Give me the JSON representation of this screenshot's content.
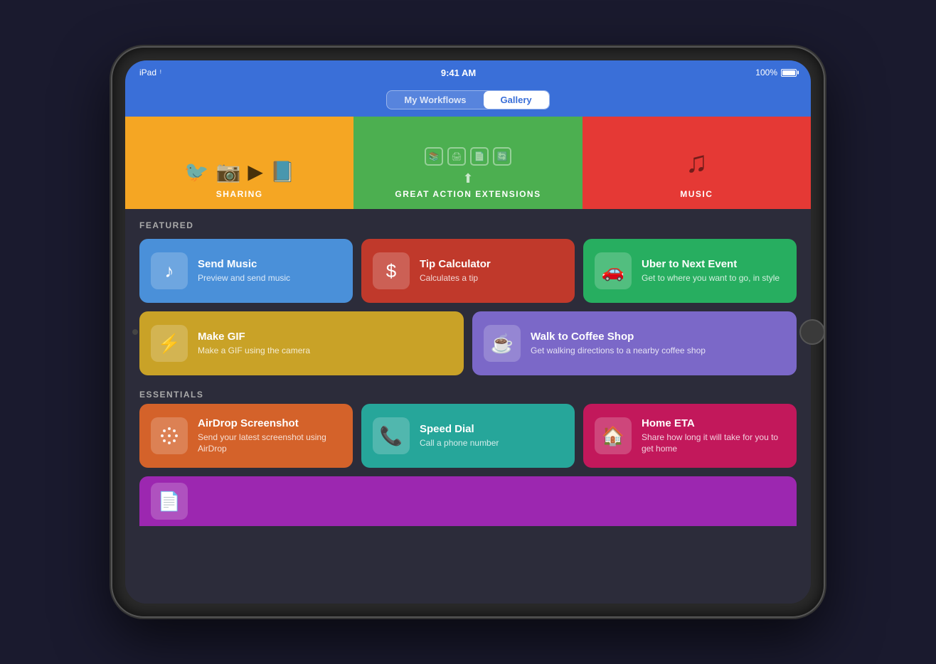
{
  "status_bar": {
    "device": "iPad",
    "wifi": "wifi",
    "time": "9:41 AM",
    "battery": "100%"
  },
  "nav": {
    "tab_my_workflows": "My Workflows",
    "tab_gallery": "Gallery",
    "active_tab": "gallery"
  },
  "banners": [
    {
      "id": "sharing",
      "label": "SHARING",
      "color": "#f5a623",
      "icons": [
        "🐦",
        "📷",
        "▶",
        "📘"
      ]
    },
    {
      "id": "extensions",
      "label": "GREAT ACTION EXTENSIONS",
      "color": "#4caf50"
    },
    {
      "id": "music",
      "label": "MUSIC",
      "color": "#e53935"
    }
  ],
  "sections": {
    "featured": {
      "title": "FEATURED",
      "cards": [
        {
          "id": "send-music",
          "title": "Send Music",
          "desc": "Preview and send music",
          "icon": "♪",
          "color": "card-blue"
        },
        {
          "id": "tip-calculator",
          "title": "Tip Calculator",
          "desc": "Calculates a tip",
          "icon": "$",
          "color": "card-red"
        },
        {
          "id": "uber-next-event",
          "title": "Uber to Next Event",
          "desc": "Get to where you want to go, in style",
          "icon": "🚗",
          "color": "card-green"
        }
      ],
      "cards2": [
        {
          "id": "make-gif",
          "title": "Make GIF",
          "desc": "Make a GIF using the camera",
          "icon": "⚡",
          "color": "card-yellow"
        },
        {
          "id": "walk-coffee-shop",
          "title": "Walk to Coffee Shop",
          "desc": "Get walking directions to a nearby coffee shop",
          "icon": "☕",
          "color": "card-purple"
        }
      ]
    },
    "essentials": {
      "title": "ESSENTIALS",
      "cards": [
        {
          "id": "airdrop-screenshot",
          "title": "AirDrop Screenshot",
          "desc": "Send your latest screenshot using AirDrop",
          "icon": "◉",
          "color": "card-orange"
        },
        {
          "id": "speed-dial",
          "title": "Speed Dial",
          "desc": "Call a phone number",
          "icon": "📞",
          "color": "card-teal"
        },
        {
          "id": "home-eta",
          "title": "Home ETA",
          "desc": "Share how long it will take for you to get home",
          "icon": "🏠",
          "color": "card-pink"
        }
      ],
      "partial_card": {
        "id": "partial",
        "icon": "📄",
        "color": "card-violet"
      }
    }
  }
}
